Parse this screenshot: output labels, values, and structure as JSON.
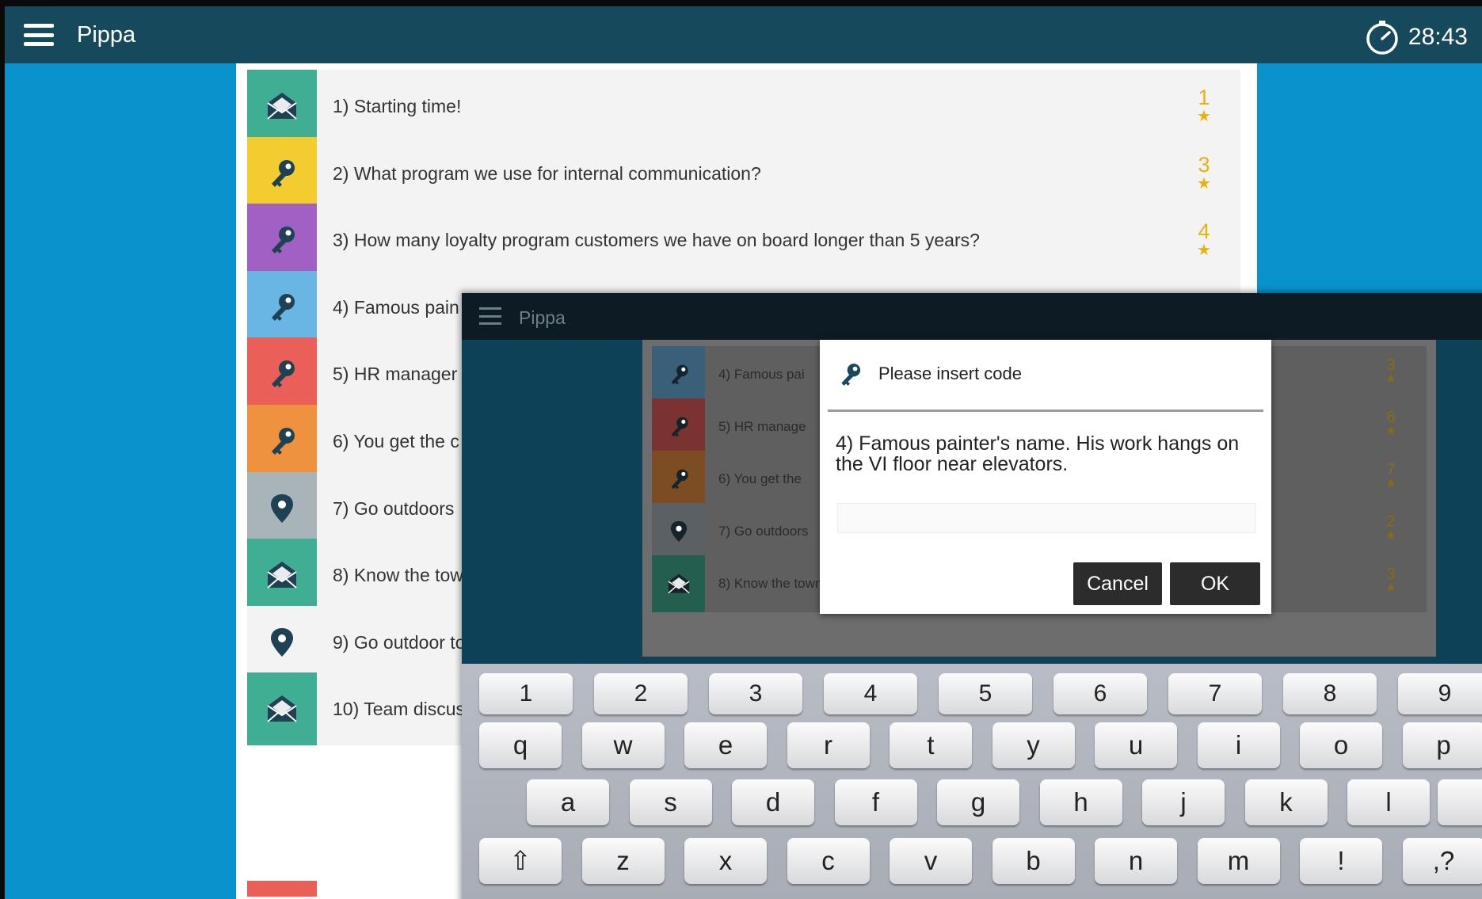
{
  "app": {
    "title": "Pippa",
    "timer": "28:43"
  },
  "tasks": [
    {
      "label": "1) Starting time!",
      "points": "1",
      "color": "#3fae92",
      "icon": "envelope-icon"
    },
    {
      "label": "2) What program we use for internal communication?",
      "points": "3",
      "color": "#f3cd2f",
      "icon": "key-icon"
    },
    {
      "label": "3) How many loyalty program customers we have on board longer than 5 years?",
      "points": "4",
      "color": "#a160c4",
      "icon": "key-icon"
    },
    {
      "label": "4) Famous pain",
      "color": "#69b5e3",
      "icon": "key-icon"
    },
    {
      "label": "5) HR manager",
      "color": "#ea6059",
      "icon": "key-icon"
    },
    {
      "label": "6) You get the c",
      "color": "#ef9240",
      "icon": "key-icon"
    },
    {
      "label": "7) Go outdoors",
      "color": "#a9b4b8",
      "icon": "location-pin-icon"
    },
    {
      "label": "8) Know the tow",
      "color": "#3fae92",
      "icon": "envelope-icon"
    },
    {
      "label": "9) Go outdoor to",
      "color": "#f3f3f3",
      "icon": "location-pin-icon"
    },
    {
      "label": "10) Team discus",
      "color": "#3fae92",
      "icon": "envelope-icon"
    }
  ],
  "overlay": {
    "app_title": "Pippa",
    "tasks": [
      {
        "label": "4) Famous pai",
        "points": "3",
        "color": "#3a5f78",
        "icon": "key-icon"
      },
      {
        "label": "5) HR manage",
        "points": "6",
        "color": "#7a3330",
        "icon": "key-icon"
      },
      {
        "label": "6) You get the",
        "points": "7",
        "color": "#7c4d22",
        "icon": "key-icon"
      },
      {
        "label": "7) Go outdoors",
        "points": "2",
        "color": "#5a6063",
        "icon": "location-pin-icon"
      },
      {
        "label": "8) Know the town!",
        "points": "3",
        "color": "#245e4e",
        "icon": "envelope-icon"
      }
    ],
    "dialog": {
      "title": "Please insert code",
      "question": "4) Famous painter's name. His work hangs on the VI floor near elevators.",
      "input_value": "",
      "cancel_label": "Cancel",
      "ok_label": "OK"
    }
  },
  "keyboard": {
    "row0": [
      "1",
      "2",
      "3",
      "4",
      "5",
      "6",
      "7",
      "8",
      "9"
    ],
    "row1": [
      "q",
      "w",
      "e",
      "r",
      "t",
      "y",
      "u",
      "i",
      "o",
      "p"
    ],
    "row2": [
      "a",
      "s",
      "d",
      "f",
      "g",
      "h",
      "j",
      "k",
      "l"
    ],
    "row3": [
      "⇧",
      "z",
      "x",
      "c",
      "v",
      "b",
      "n",
      "m",
      "!",
      ",?"
    ]
  },
  "colors": {
    "background": "#0a92cc",
    "topbar": "#17495c",
    "star": "#e8b20d"
  }
}
